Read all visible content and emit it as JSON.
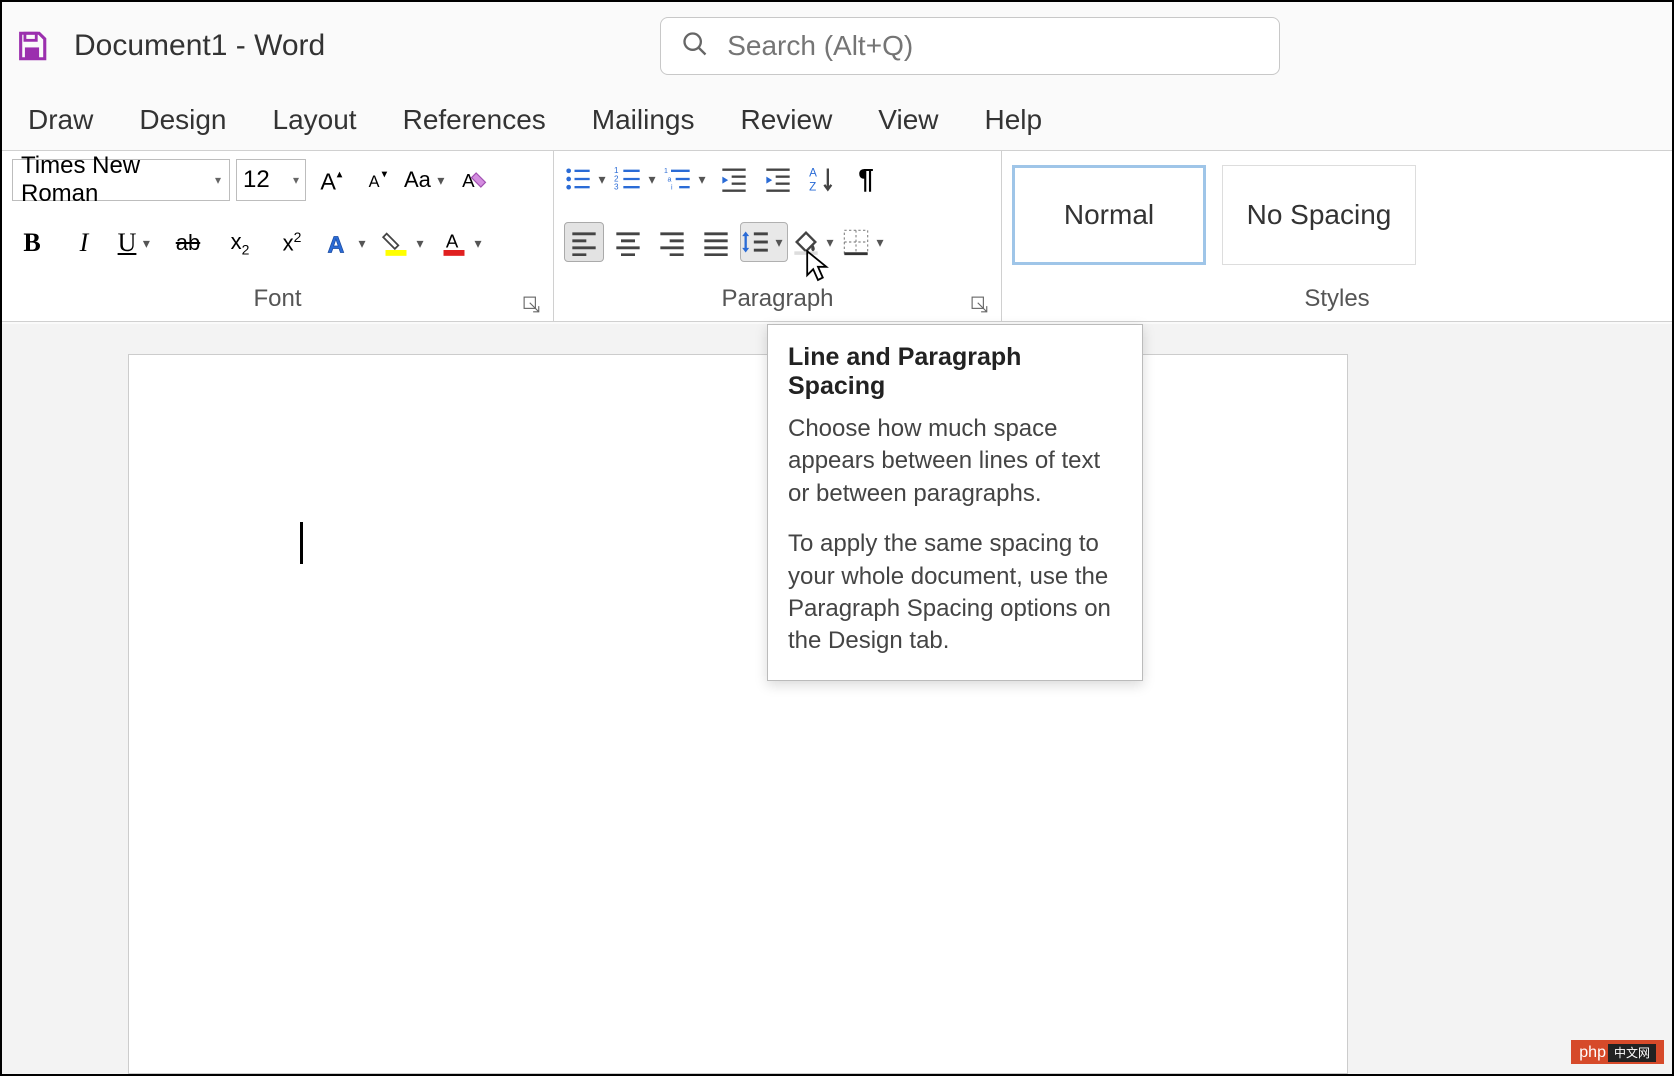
{
  "title": "Document1 - Word",
  "search_placeholder": "Search (Alt+Q)",
  "tabs": {
    "draw": "Draw",
    "design": "Design",
    "layout": "Layout",
    "references": "References",
    "mailings": "Mailings",
    "review": "Review",
    "view": "View",
    "help": "Help"
  },
  "font": {
    "name": "Times New Roman",
    "size": "12",
    "group_label": "Font"
  },
  "paragraph": {
    "group_label": "Paragraph"
  },
  "styles": {
    "group_label": "Styles",
    "normal": "Normal",
    "nospacing": "No Spacing"
  },
  "tooltip": {
    "title": "Line and Paragraph Spacing",
    "p1": "Choose how much space appears between lines of text or between paragraphs.",
    "p2": "To apply the same spacing to your whole document, use the Paragraph Spacing options on the Design tab."
  },
  "watermark": {
    "brand": "php",
    "cn": "中文网"
  }
}
